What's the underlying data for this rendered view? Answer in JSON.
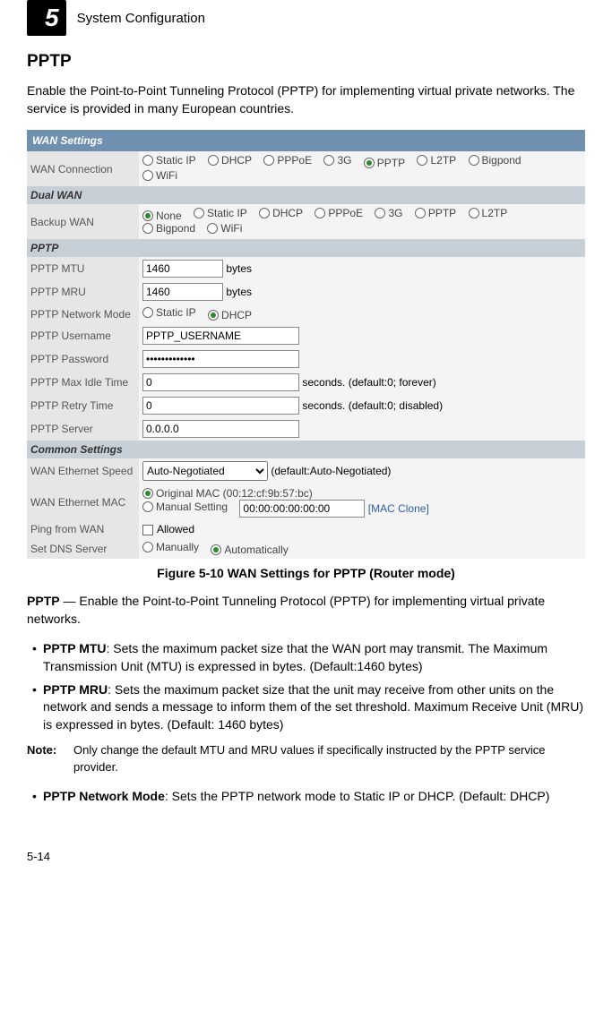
{
  "header": {
    "chapter_number": "5",
    "chapter_title": "System Configuration"
  },
  "section": {
    "title": "PPTP",
    "intro": "Enable the Point-to-Point Tunneling Protocol (PPTP) for implementing virtual private networks. The service is provided in many European countries."
  },
  "table": {
    "header": "WAN Settings",
    "rows": {
      "wan_conn": {
        "label": "WAN Connection",
        "options": [
          "Static IP",
          "DHCP",
          "PPPoE",
          "3G",
          "PPTP",
          "L2TP",
          "Bigpond",
          "WiFi"
        ],
        "selected": "PPTP"
      },
      "dual_wan_header": "Dual WAN",
      "backup_wan": {
        "label": "Backup WAN",
        "options": [
          "None",
          "Static IP",
          "DHCP",
          "PPPoE",
          "3G",
          "PPTP",
          "L2TP",
          "Bigpond",
          "WiFi"
        ],
        "selected": "None"
      },
      "pptp_header": "PPTP",
      "pptp_mtu": {
        "label": "PPTP MTU",
        "value": "1460",
        "unit": "bytes"
      },
      "pptp_mru": {
        "label": "PPTP MRU",
        "value": "1460",
        "unit": "bytes"
      },
      "pptp_net_mode": {
        "label": "PPTP Network Mode",
        "options": [
          "Static IP",
          "DHCP"
        ],
        "selected": "DHCP"
      },
      "pptp_user": {
        "label": "PPTP Username",
        "value": "PPTP_USERNAME"
      },
      "pptp_pass": {
        "label": "PPTP Password",
        "value": "•••••••••••••"
      },
      "pptp_idle": {
        "label": "PPTP Max Idle Time",
        "value": "0",
        "hint": "seconds. (default:0; forever)"
      },
      "pptp_retry": {
        "label": "PPTP Retry Time",
        "value": "0",
        "hint": "seconds. (default:0; disabled)"
      },
      "pptp_server": {
        "label": "PPTP Server",
        "value": "0.0.0.0"
      },
      "common_header": "Common Settings",
      "wan_speed": {
        "label": "WAN Ethernet Speed",
        "value": "Auto-Negotiated",
        "hint": "(default:Auto-Negotiated)"
      },
      "wan_mac": {
        "label": "WAN Ethernet MAC",
        "original_label": "Original MAC (00:12:cf:9b:57:bc)",
        "manual_label": "Manual Setting",
        "manual_value": "00:00:00:00:00:00",
        "clone_label": "[MAC Clone]",
        "selected": "original"
      },
      "ping": {
        "label": "Ping from WAN",
        "allowed_label": "Allowed"
      },
      "dns": {
        "label": "Set DNS Server",
        "options": [
          "Manually",
          "Automatically"
        ],
        "selected": "Automatically"
      }
    }
  },
  "figure_caption": "Figure 5-10  WAN Settings for PPTP (Router mode)",
  "desc": {
    "lead_bold": "PPTP",
    "lead_rest": " — Enable the Point-to-Point Tunneling Protocol (PPTP) for implementing virtual private networks.",
    "bullets": [
      {
        "bold": "PPTP MTU",
        "rest": ": Sets the maximum packet size that the WAN port may transmit. The Maximum Transmission Unit (MTU) is expressed in bytes. (Default:1460 bytes)"
      },
      {
        "bold": "PPTP MRU",
        "rest": ": Sets the maximum packet size that the unit may receive from other units on the network and sends a message to inform them of the set threshold. Maximum Receive Unit (MRU) is expressed in bytes. (Default: 1460 bytes)"
      }
    ],
    "note_label": "Note:",
    "note_text": "Only change the default MTU and MRU values if specifically instructed by the PPTP service provider.",
    "bullet3": {
      "bold": "PPTP Network Mode",
      "rest": ": Sets the PPTP network mode to Static IP or DHCP. (Default: DHCP)"
    }
  },
  "page_number": "5-14"
}
